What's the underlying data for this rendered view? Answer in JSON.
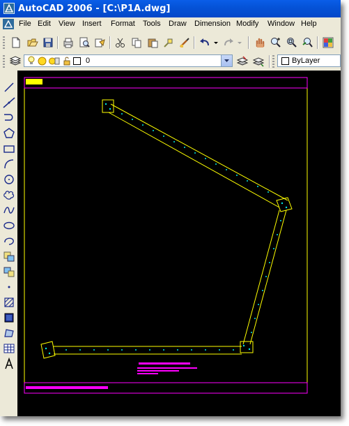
{
  "window": {
    "title": "AutoCAD 2006 - [C:\\P1A.dwg]"
  },
  "menu": {
    "items": [
      "File",
      "Edit",
      "View",
      "Insert",
      "Format",
      "Tools",
      "Draw",
      "Dimension",
      "Modify",
      "Window",
      "Help"
    ]
  },
  "layers_toolbar": {
    "current_layer": "0",
    "color_control": "ByLayer"
  },
  "icons": {
    "standard": [
      "new-icon",
      "open-icon",
      "save-icon",
      "plot-icon",
      "plot-preview-icon",
      "publish-icon",
      "cut-icon",
      "copy-icon",
      "paste-icon",
      "match-properties-icon",
      "block-editor-icon",
      "undo-icon",
      "redo-icon",
      "pan-icon",
      "zoom-realtime-icon",
      "zoom-window-icon",
      "zoom-previous-icon",
      "properties-icon"
    ],
    "draw": [
      "line-icon",
      "construction-line-icon",
      "polyline-icon",
      "polygon-icon",
      "rectangle-icon",
      "arc-icon",
      "circle-icon",
      "revision-cloud-icon",
      "spline-icon",
      "ellipse-icon",
      "ellipse-arc-icon",
      "insert-block-icon",
      "make-block-icon",
      "point-icon",
      "hatch-icon",
      "gradient-icon",
      "region-icon",
      "table-icon",
      "multiline-text-icon"
    ]
  },
  "colors": {
    "title_bar": "#0553d8",
    "drawing_background": "#000000",
    "wall_outline": "#ffff00",
    "title_block": "#ff00ff",
    "pier_marks": "#00e5e5"
  }
}
